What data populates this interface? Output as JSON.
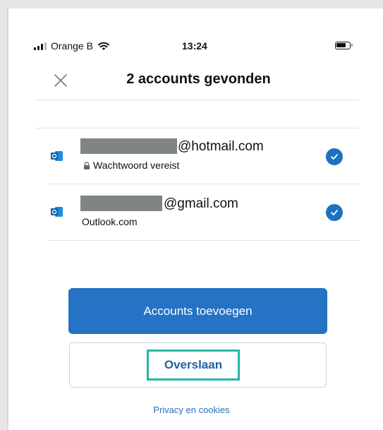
{
  "status_bar": {
    "carrier": "Orange B",
    "time": "13:24"
  },
  "header": {
    "title": "2 accounts gevonden",
    "close_icon": "close-icon"
  },
  "accounts": [
    {
      "email_domain": "@hotmail.com",
      "subtitle": "Wachtwoord vereist",
      "locked": true,
      "selected": true,
      "icon": "outlook-icon"
    },
    {
      "email_domain": "@gmail.com",
      "subtitle": "Outlook.com",
      "locked": false,
      "selected": true,
      "icon": "outlook-icon"
    }
  ],
  "actions": {
    "primary_label": "Accounts toevoegen",
    "secondary_label": "Overslaan",
    "privacy_link": "Privacy en cookies"
  },
  "colors": {
    "accent": "#2672c4",
    "check": "#1f70c1",
    "highlight": "#25b7a7",
    "link": "#2c6fbe",
    "redaction": "#7f8584"
  }
}
